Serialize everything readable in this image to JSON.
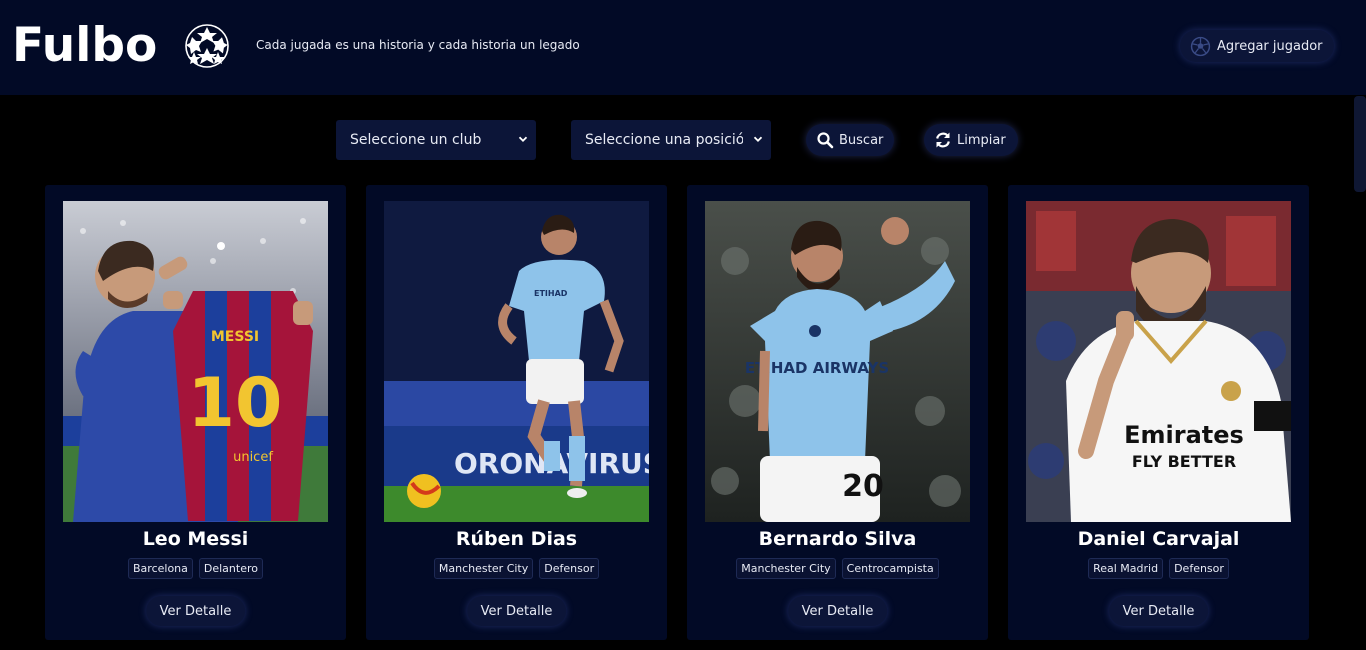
{
  "header": {
    "brand": "Fulbo",
    "tagline": "Cada jugada es una historia y cada historia un legado",
    "add_player_label": "Agregar jugador",
    "logo_icon": "champions-league-ball-icon"
  },
  "filters": {
    "club_select": "Seleccione un club",
    "position_select": "Seleccione una posición",
    "search_label": "Buscar",
    "clear_label": "Limpiar"
  },
  "players": [
    {
      "name": "Leo Messi",
      "club": "Barcelona",
      "position": "Delantero",
      "detail_label": "Ver Detalle"
    },
    {
      "name": "Rúben Dias",
      "club": "Manchester City",
      "position": "Defensor",
      "detail_label": "Ver Detalle"
    },
    {
      "name": "Bernardo Silva",
      "club": "Manchester City",
      "position": "Centrocampista",
      "detail_label": "Ver Detalle"
    },
    {
      "name": "Daniel Carvajal",
      "club": "Real Madrid",
      "position": "Defensor",
      "detail_label": "Ver Detalle"
    }
  ],
  "photo_texts": {
    "messi_jersey_name": "MESSI",
    "messi_jersey_number": "10",
    "messi_sponsor": "unicef",
    "dias_shirt_sponsor": "ETIHAD",
    "dias_boards": "ORONAVIRUS · CI",
    "silva_sponsor": "ETIHAD AIRWAYS",
    "silva_shorts_number": "20",
    "carvajal_sponsor_line1": "Emirates",
    "carvajal_sponsor_line2": "FLY BETTER"
  },
  "colors": {
    "header_bg": "#020a26",
    "card_bg": "#020a26",
    "control_bg": "#0c1538",
    "page_bg": "#000000",
    "city_blue": "#8ec3ea",
    "barca_blue": "#1c3f9c",
    "barca_red": "#b3123a"
  }
}
